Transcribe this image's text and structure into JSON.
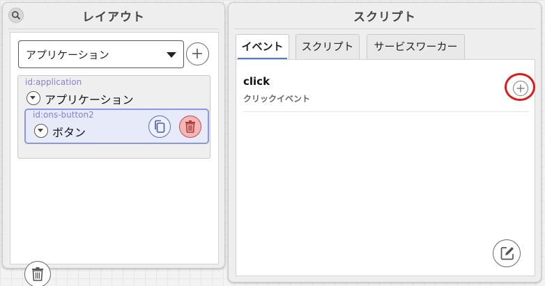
{
  "layout_panel": {
    "title": "レイアウト",
    "select": {
      "value": "アプリケーション"
    },
    "tree": {
      "root": {
        "id_label": "id:application",
        "label": "アプリケーション"
      },
      "selected": {
        "id_label": "id:ons-button2",
        "label": "ボタン"
      }
    }
  },
  "script_panel": {
    "title": "スクリプト",
    "tabs": [
      {
        "label": "イベント",
        "active": true
      },
      {
        "label": "スクリプト",
        "active": false
      },
      {
        "label": "サービスワーカー",
        "active": false
      }
    ],
    "events": [
      {
        "name": "click",
        "description": "クリックイベント"
      }
    ]
  },
  "colors": {
    "accent": "#4c79d8",
    "selection_border": "#8a97e0",
    "node_id_text": "#8a7fd0",
    "delete_red": "#c84a4a",
    "highlight_red": "#e01818"
  },
  "icons": {
    "search": "search-icon",
    "add": "plus-icon",
    "dropdown": "caret-down-icon",
    "collapse": "chevron-down-circle-icon",
    "copy": "copy-icon",
    "delete": "trash-icon",
    "edit": "edit-icon"
  }
}
